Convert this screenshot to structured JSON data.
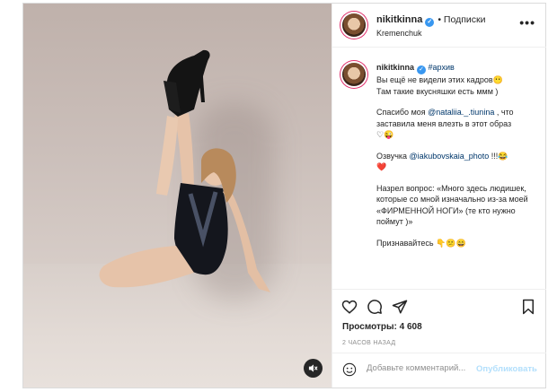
{
  "header": {
    "username": "nikitkinna",
    "follow_label": "• Подписки",
    "location": "Kremenchuk",
    "more_label": "•••"
  },
  "caption": {
    "username": "nikitkinna",
    "hashtag": "#архив",
    "p1_line1": "Вы ещё не видели этих кадров",
    "p1_emoji": "😶",
    "p1_line2": "Там такие вкусняшки есть ммм )",
    "p2_prefix": "Спасибо моя ",
    "p2_tag": "@nataliia._.tiunina",
    "p2_suffix": " , что заставила меня влезть в этот образ ",
    "p2_emoji": "♡😜",
    "p3_prefix": "Озвучка ",
    "p3_tag": "@iakubovskaia_photo",
    "p3_suffix": " !!!😂",
    "p3_emoji": "❤️",
    "p4": "Назрел вопрос: «Много здесь людишек, которые со мной изначально из-за моей «ФИРМЕННОЙ НОГИ» (те кто нужно поймут )»",
    "p5": "Признавайтесь 👇😕😄"
  },
  "stats": {
    "views_label": "Просмотры: 4 608",
    "time_label": "2 ЧАСОВ НАЗАД"
  },
  "comment_box": {
    "placeholder": "Добавьте комментарий...",
    "publish_label": "Опубликовать"
  },
  "colors": {
    "link": "#00376b",
    "verified": "#3897f0",
    "publish_disabled": "#b2dffc"
  }
}
